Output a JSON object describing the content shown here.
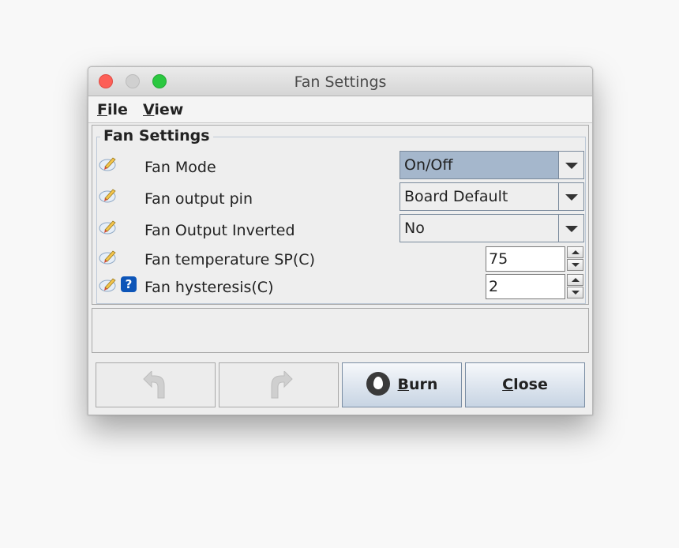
{
  "window": {
    "title": "Fan Settings"
  },
  "menubar": {
    "items": [
      {
        "mnemonic": "F",
        "rest": "ile"
      },
      {
        "mnemonic": "V",
        "rest": "iew"
      }
    ]
  },
  "settings": {
    "group_title": "Fan Settings",
    "rows": [
      {
        "label": "Fan Mode",
        "control": "combo",
        "value": "On/Off"
      },
      {
        "label": "Fan output pin",
        "control": "combo",
        "value": "Board Default"
      },
      {
        "label": "Fan Output Inverted",
        "control": "combo",
        "value": "No"
      },
      {
        "label": "Fan temperature SP(C)",
        "control": "spinner",
        "value": "75"
      },
      {
        "label": "Fan hysteresis(C)",
        "control": "spinner",
        "value": "2",
        "has_help": true
      }
    ]
  },
  "buttons": {
    "undo_icon": "undo-arrow-icon",
    "redo_icon": "redo-arrow-icon",
    "burn": {
      "mnemonic": "B",
      "rest": "urn",
      "icon": "flame-icon"
    },
    "close": {
      "mnemonic": "C",
      "rest": "lose"
    }
  },
  "colors": {
    "selected_combo": "#a5b7cc",
    "help_icon": "#0d55b8",
    "close_light": "#fd5f57",
    "max_light": "#2bc840"
  }
}
